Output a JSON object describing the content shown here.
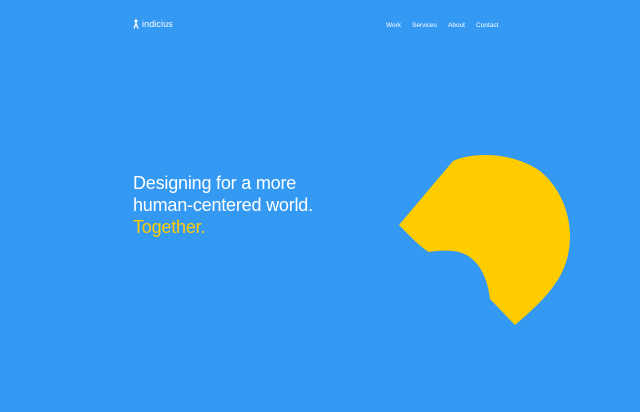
{
  "header": {
    "logo_text": "indicius",
    "nav": [
      "Work",
      "Services",
      "About",
      "Contact"
    ]
  },
  "hero": {
    "line1": "Designing for a more",
    "line2": "human-centered world.",
    "line3": "Together."
  },
  "colors": {
    "background": "#3399f3",
    "accent": "#ffcc00",
    "text": "#ffffff"
  },
  "decoration": {
    "shape": "yellow-abstract-blob-shape"
  }
}
